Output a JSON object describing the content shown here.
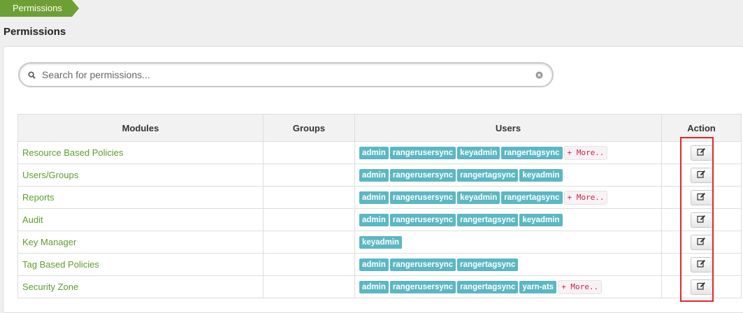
{
  "breadcrumb": {
    "item": "Permissions"
  },
  "page": {
    "title": "Permissions"
  },
  "search": {
    "placeholder": "Search for permissions...",
    "value": ""
  },
  "table": {
    "headers": {
      "modules": "Modules",
      "groups": "Groups",
      "users": "Users",
      "action": "Action"
    },
    "rows": [
      {
        "module": "Resource Based Policies",
        "groups": "",
        "users": [
          "admin",
          "rangerusersync",
          "keyadmin",
          "rangertagsync"
        ],
        "more": "+ More.."
      },
      {
        "module": "Users/Groups",
        "groups": "",
        "users": [
          "admin",
          "rangerusersync",
          "rangertagsync",
          "keyadmin"
        ],
        "more": ""
      },
      {
        "module": "Reports",
        "groups": "",
        "users": [
          "admin",
          "rangerusersync",
          "keyadmin",
          "rangertagsync"
        ],
        "more": "+ More.."
      },
      {
        "module": "Audit",
        "groups": "",
        "users": [
          "admin",
          "rangerusersync",
          "rangertagsync",
          "keyadmin"
        ],
        "more": ""
      },
      {
        "module": "Key Manager",
        "groups": "",
        "users": [
          "keyadmin"
        ],
        "more": ""
      },
      {
        "module": "Tag Based Policies",
        "groups": "",
        "users": [
          "admin",
          "rangerusersync",
          "rangertagsync"
        ],
        "more": ""
      },
      {
        "module": "Security Zone",
        "groups": "",
        "users": [
          "admin",
          "rangerusersync",
          "rangertagsync",
          "yarn-ats"
        ],
        "more": "+ More.."
      }
    ]
  },
  "colors": {
    "accent": "#6ca034",
    "link": "#5d9c2d",
    "tag": "#5bb7c4",
    "more_text": "#c7254e",
    "highlight": "#e3262a"
  },
  "icons": {
    "search": "search-icon",
    "clear": "clear-icon",
    "edit": "edit-icon"
  }
}
